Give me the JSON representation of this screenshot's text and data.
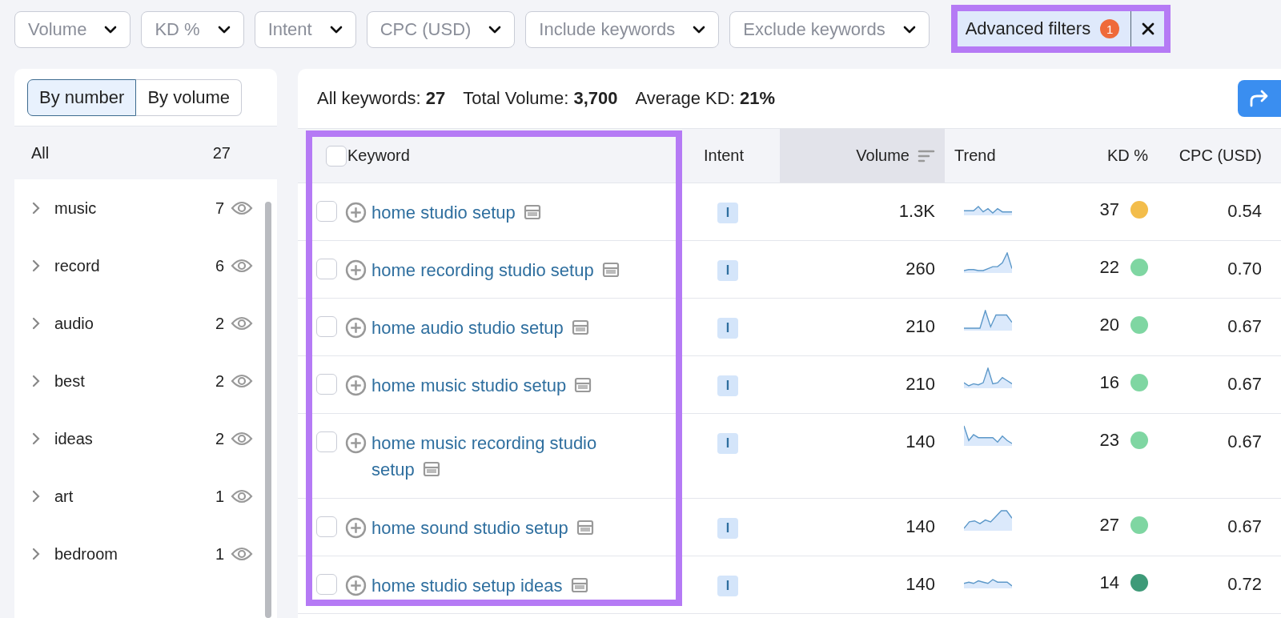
{
  "filters": [
    {
      "label": "Volume"
    },
    {
      "label": "KD %"
    },
    {
      "label": "Intent"
    },
    {
      "label": "CPC (USD)"
    },
    {
      "label": "Include keywords"
    },
    {
      "label": "Exclude keywords"
    }
  ],
  "advanced_filters": {
    "label": "Advanced filters",
    "badge": "1",
    "highlighted": true
  },
  "sidebar": {
    "toggle": [
      {
        "label": "By number",
        "selected": true
      },
      {
        "label": "By volume",
        "selected": false
      }
    ],
    "all": {
      "label": "All",
      "count": "27"
    },
    "items": [
      {
        "label": "music",
        "count": "7",
        "expanded": false
      },
      {
        "label": "record",
        "count": "6",
        "expanded": false
      },
      {
        "label": "audio",
        "count": "2",
        "expanded": false
      },
      {
        "label": "best",
        "count": "2",
        "expanded": false
      },
      {
        "label": "ideas",
        "count": "2",
        "expanded": false
      },
      {
        "label": "art",
        "count": "1",
        "expanded": false
      },
      {
        "label": "bedroom",
        "count": "1",
        "expanded": false
      }
    ]
  },
  "summary": [
    "All keywords: **27**",
    "Total Volume: **3,700**",
    "Average KD: **21%**"
  ],
  "table": {
    "keyword_column_highlighted": true,
    "select_all_checked": false,
    "columns": [
      {
        "label": "Keyword",
        "sorted": false
      },
      {
        "label": "Intent",
        "sorted": false
      },
      {
        "label": "Volume",
        "sorted": true
      },
      {
        "label": "Trend",
        "sorted": false
      },
      {
        "label": "KD %",
        "sorted": false
      },
      {
        "label": "CPC (USD)",
        "sorted": false
      }
    ],
    "rows": [
      {
        "checked": false,
        "keyword": "home studio setup",
        "intent": "I",
        "volume": "1.3K",
        "kd": "37",
        "color": "#f3bd4b",
        "cpc": "0.54"
      },
      {
        "checked": false,
        "keyword": "home recording studio setup",
        "intent": "I",
        "volume": "260",
        "kd": "22",
        "color": "#7fd6a2",
        "cpc": "0.70"
      },
      {
        "checked": false,
        "keyword": "home audio studio setup",
        "intent": "I",
        "volume": "210",
        "kd": "20",
        "color": "#7fd6a2",
        "cpc": "0.67"
      },
      {
        "checked": false,
        "keyword": "home music studio setup",
        "intent": "I",
        "volume": "210",
        "kd": "16",
        "color": "#7fd6a2",
        "cpc": "0.67"
      },
      {
        "checked": false,
        "keyword": "home music recording studio setup",
        "intent": "I",
        "volume": "140",
        "kd": "23",
        "color": "#7fd6a2",
        "cpc": "0.67"
      },
      {
        "checked": false,
        "keyword": "home sound studio setup",
        "intent": "I",
        "volume": "140",
        "kd": "27",
        "color": "#7fd6a2",
        "cpc": "0.67"
      },
      {
        "checked": false,
        "keyword": "home studio setup ideas",
        "intent": "I",
        "volume": "140",
        "kd": "14",
        "color": "#3e9a78",
        "cpc": "0.72"
      }
    ]
  }
}
